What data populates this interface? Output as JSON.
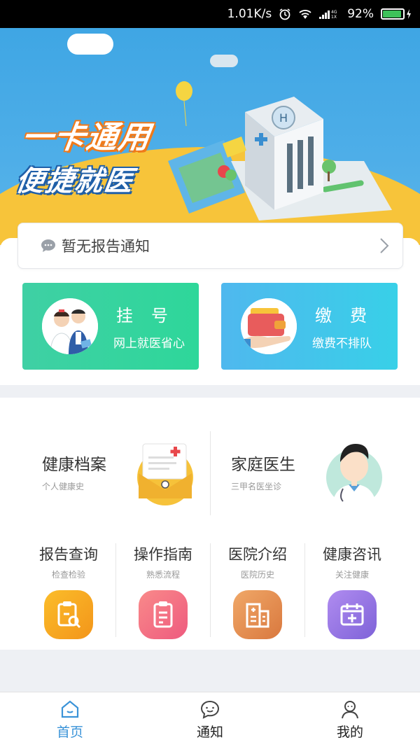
{
  "status_bar": {
    "speed": "1.01K/s",
    "battery": "92%",
    "battery_level": 0.92,
    "network": "4G 1X"
  },
  "banner": {
    "slogan_line1": "一卡通用",
    "slogan_line2": "便捷就医",
    "hospital_sign": "H"
  },
  "notice": {
    "text": "暂无报告通知"
  },
  "cards": [
    {
      "title": "挂号",
      "subtitle": "网上就医省心",
      "color": "#33d59c"
    },
    {
      "title": "缴费",
      "subtitle": "缴费不排队",
      "color": "#45c3ec"
    }
  ],
  "features": [
    {
      "title": "健康档案",
      "subtitle": "个人健康史"
    },
    {
      "title": "家庭医生",
      "subtitle": "三甲名医坐诊"
    }
  ],
  "grid": [
    {
      "title": "报告查询",
      "subtitle": "检查检验",
      "icon": "report-search-icon",
      "color": "#f6a51f"
    },
    {
      "title": "操作指南",
      "subtitle": "熟悉流程",
      "icon": "guide-clipboard-icon",
      "color": "#f2687e"
    },
    {
      "title": "医院介绍",
      "subtitle": "医院历史",
      "icon": "hospital-building-icon",
      "color": "#e28c54"
    },
    {
      "title": "健康咨讯",
      "subtitle": "关注健康",
      "icon": "calendar-plus-icon",
      "color": "#8f74e0"
    }
  ],
  "tabbar": [
    {
      "label": "首页",
      "icon": "home-icon",
      "active": true
    },
    {
      "label": "通知",
      "icon": "chat-smile-icon",
      "active": false
    },
    {
      "label": "我的",
      "icon": "person-icon",
      "active": false
    }
  ],
  "colors": {
    "accent": "#3a93d8",
    "banner_sky": "#4eaee8",
    "banner_ground": "#f7c43a"
  }
}
